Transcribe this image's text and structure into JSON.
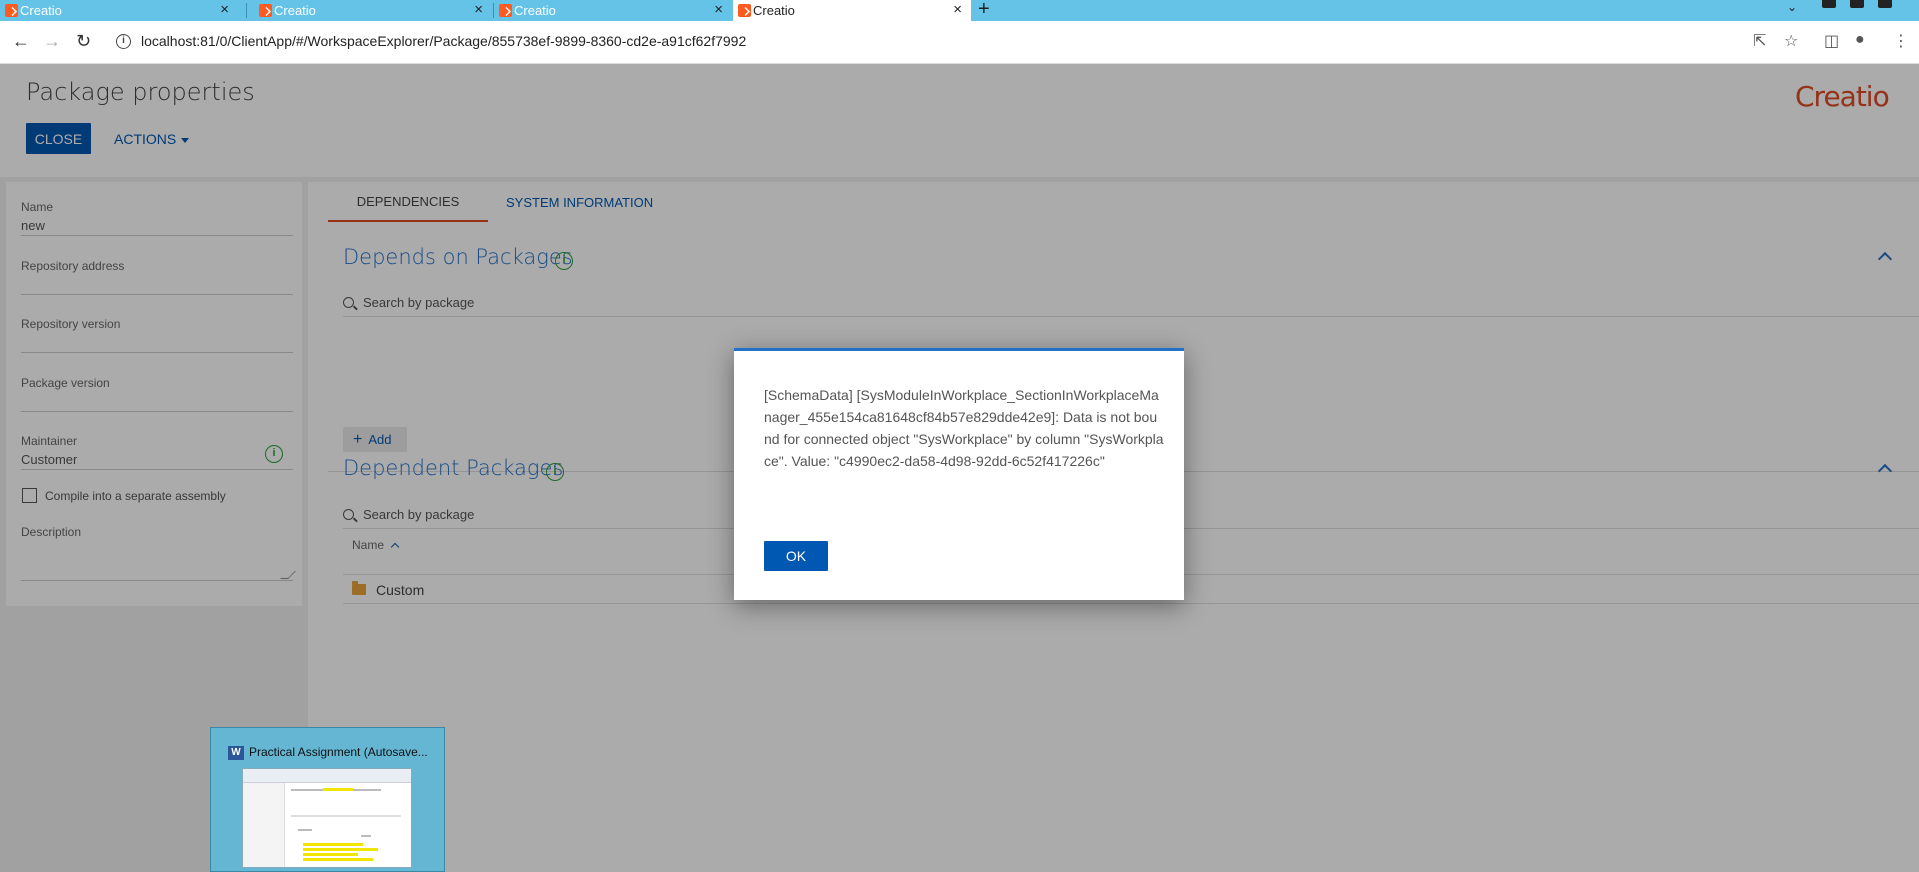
{
  "browser": {
    "tabs": [
      {
        "label": "Creatio",
        "active": false
      },
      {
        "label": "Creatio",
        "active": false
      },
      {
        "label": "Creatio",
        "active": false
      },
      {
        "label": "Creatio",
        "active": true
      }
    ],
    "tab_close_glyph": "×",
    "new_tab_glyph": "+",
    "url": "localhost:81/0/ClientApp/#/WorkspaceExplorer/Package/855738ef-9899-8360-cd2e-a91cf62f7992",
    "icons": [
      "back-icon",
      "forward-icon",
      "reload-icon",
      "site-info-icon",
      "share-icon",
      "star-icon",
      "sidebar-icon",
      "profile-icon",
      "menu-icon"
    ]
  },
  "header": {
    "title": "Package properties",
    "close_label": "CLOSE",
    "actions_label": "ACTIONS",
    "logo_text": "Creatio"
  },
  "left_panel": {
    "name_label": "Name",
    "name_value": "new",
    "repo_address_label": "Repository address",
    "repo_address_value": "",
    "repo_version_label": "Repository version",
    "repo_version_value": "",
    "package_version_label": "Package version",
    "package_version_value": "",
    "maintainer_label": "Maintainer",
    "maintainer_value": "Customer",
    "compile_label": "Compile into a separate assembly",
    "compile_checked": false,
    "description_label": "Description",
    "description_value": ""
  },
  "main": {
    "tabs": [
      {
        "label": "DEPENDENCIES",
        "active": true
      },
      {
        "label": "SYSTEM INFORMATION",
        "active": false
      }
    ],
    "depends_on": {
      "title": "Depends on Packages",
      "search_placeholder": "Search by package",
      "add_label": "Add"
    },
    "dependent": {
      "title": "Dependent Packages",
      "search_placeholder": "Search by package",
      "column_name": "Name",
      "rows": [
        {
          "name": "Custom"
        }
      ]
    }
  },
  "modal": {
    "message": "[SchemaData] [SysModuleInWorkplace_SectionInWorkplaceManager_455e154ca81648cf84b57e829dde42e9]: Data is not bound for connected object \"SysWorkplace\" by column \"SysWorkplace\". Value: \"c4990ec2-da58-4d98-92dd-6c52f417226c\"",
    "ok_label": "OK"
  },
  "taskbar_preview": {
    "app_icon_letter": "W",
    "title": "Practical Assignment (Autosave..."
  },
  "colors": {
    "accent_blue": "#0058b3",
    "brand_orange": "#e04b24",
    "section_blue": "#2472c8",
    "info_green": "#2d9e3a",
    "tabstrip": "#64c3e6"
  }
}
